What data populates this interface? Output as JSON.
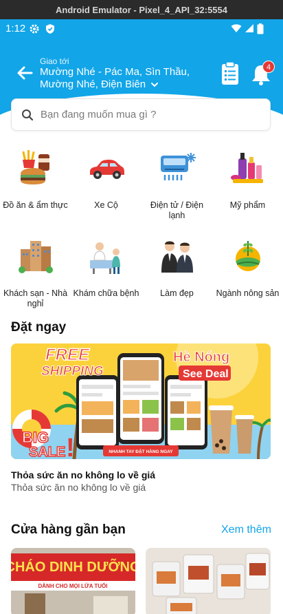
{
  "window": {
    "title": "Android Emulator - Pixel_4_API_32:5554"
  },
  "status_bar": {
    "time": "1:12"
  },
  "header": {
    "deliver_label": "Giao tới",
    "address": "Mường Nhé - Pác Ma, Sìn Thầu, Mường Nhé, Điện Biên",
    "notification_count": "4",
    "color": "#12a5e8"
  },
  "search": {
    "placeholder": "Bạn đang muốn mua gì ?"
  },
  "categories": [
    {
      "label": "Đồ ăn & ẩm thực",
      "icon": "food-icon"
    },
    {
      "label": "Xe Cộ",
      "icon": "car-icon"
    },
    {
      "label": "Điện tử / Điện lạnh",
      "icon": "air-conditioner-icon"
    },
    {
      "label": "Mỹ phẩm",
      "icon": "cosmetics-icon"
    },
    {
      "label": "Khách sạn - Nhà nghỉ",
      "icon": "hotel-icon"
    },
    {
      "label": "Khám chữa bệnh",
      "icon": "doctor-icon"
    },
    {
      "label": "Làm đẹp",
      "icon": "beauty-icon"
    },
    {
      "label": "Ngành nông sản",
      "icon": "agriculture-icon"
    }
  ],
  "order_now": {
    "title": "Đặt ngay",
    "banner": {
      "free": "FREE",
      "shipping": "SHIPPING",
      "big": "BIG",
      "sale": "SALE",
      "summer": "Hè Nóng",
      "see_deal": "See Deal",
      "cta": "NHANH TAY ĐẶT HÀNG NGAY"
    },
    "deal_title": "Thỏa sức ăn no không lo về giá",
    "deal_subtitle": "Thỏa sức ăn no không lo về giá"
  },
  "nearby": {
    "title": "Cửa hàng gần bạn",
    "more": "Xem thêm",
    "store1_sign": "CHÁO DINH DƯỠNG",
    "store1_sub": "DÀNH CHO MỌI LỨA TUỔI"
  }
}
